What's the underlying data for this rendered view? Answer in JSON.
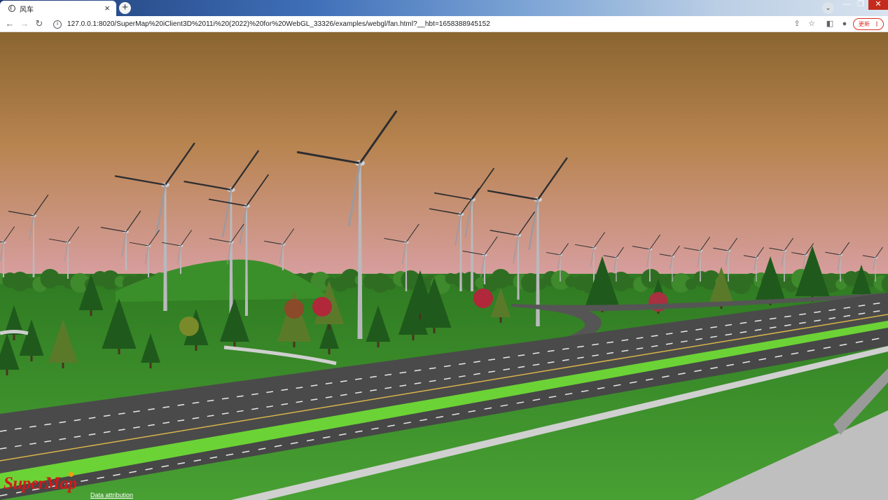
{
  "browser": {
    "tab": {
      "title": "风车",
      "close_glyph": "×"
    },
    "new_tab_glyph": "+",
    "tab_search_glyph": "⌄",
    "window_controls": {
      "minimize": "—",
      "maximize": "❐",
      "close": "✕"
    },
    "toolbar": {
      "back_glyph": "←",
      "forward_glyph": "→",
      "reload_glyph": "↻",
      "info_glyph": "i",
      "url": "127.0.0.1:8020/SuperMap%20iClient3D%2011i%20(2022)%20for%20WebGL_33326/examples/webgl/fan.html?__hbt=1658388945152",
      "share_glyph": "⇪",
      "star_glyph": "☆",
      "side_panel_glyph": "◧",
      "profile_glyph": "●",
      "update_label": "更新",
      "menu_glyph": "⋮"
    }
  },
  "scene": {
    "logo_text": "SuperMap",
    "attribution_text": "Data attribution",
    "colors": {
      "sky_top": "#8a6530",
      "sky_mid": "#b88450",
      "sky_horizon": "#d9a0a4",
      "grass": "#3f8f2c",
      "grass_dark": "#2d6f1f",
      "road": "#4a4a4a",
      "median": "#6cd336",
      "tower": "#b9b9bd",
      "blade": "#2e2e30"
    }
  }
}
